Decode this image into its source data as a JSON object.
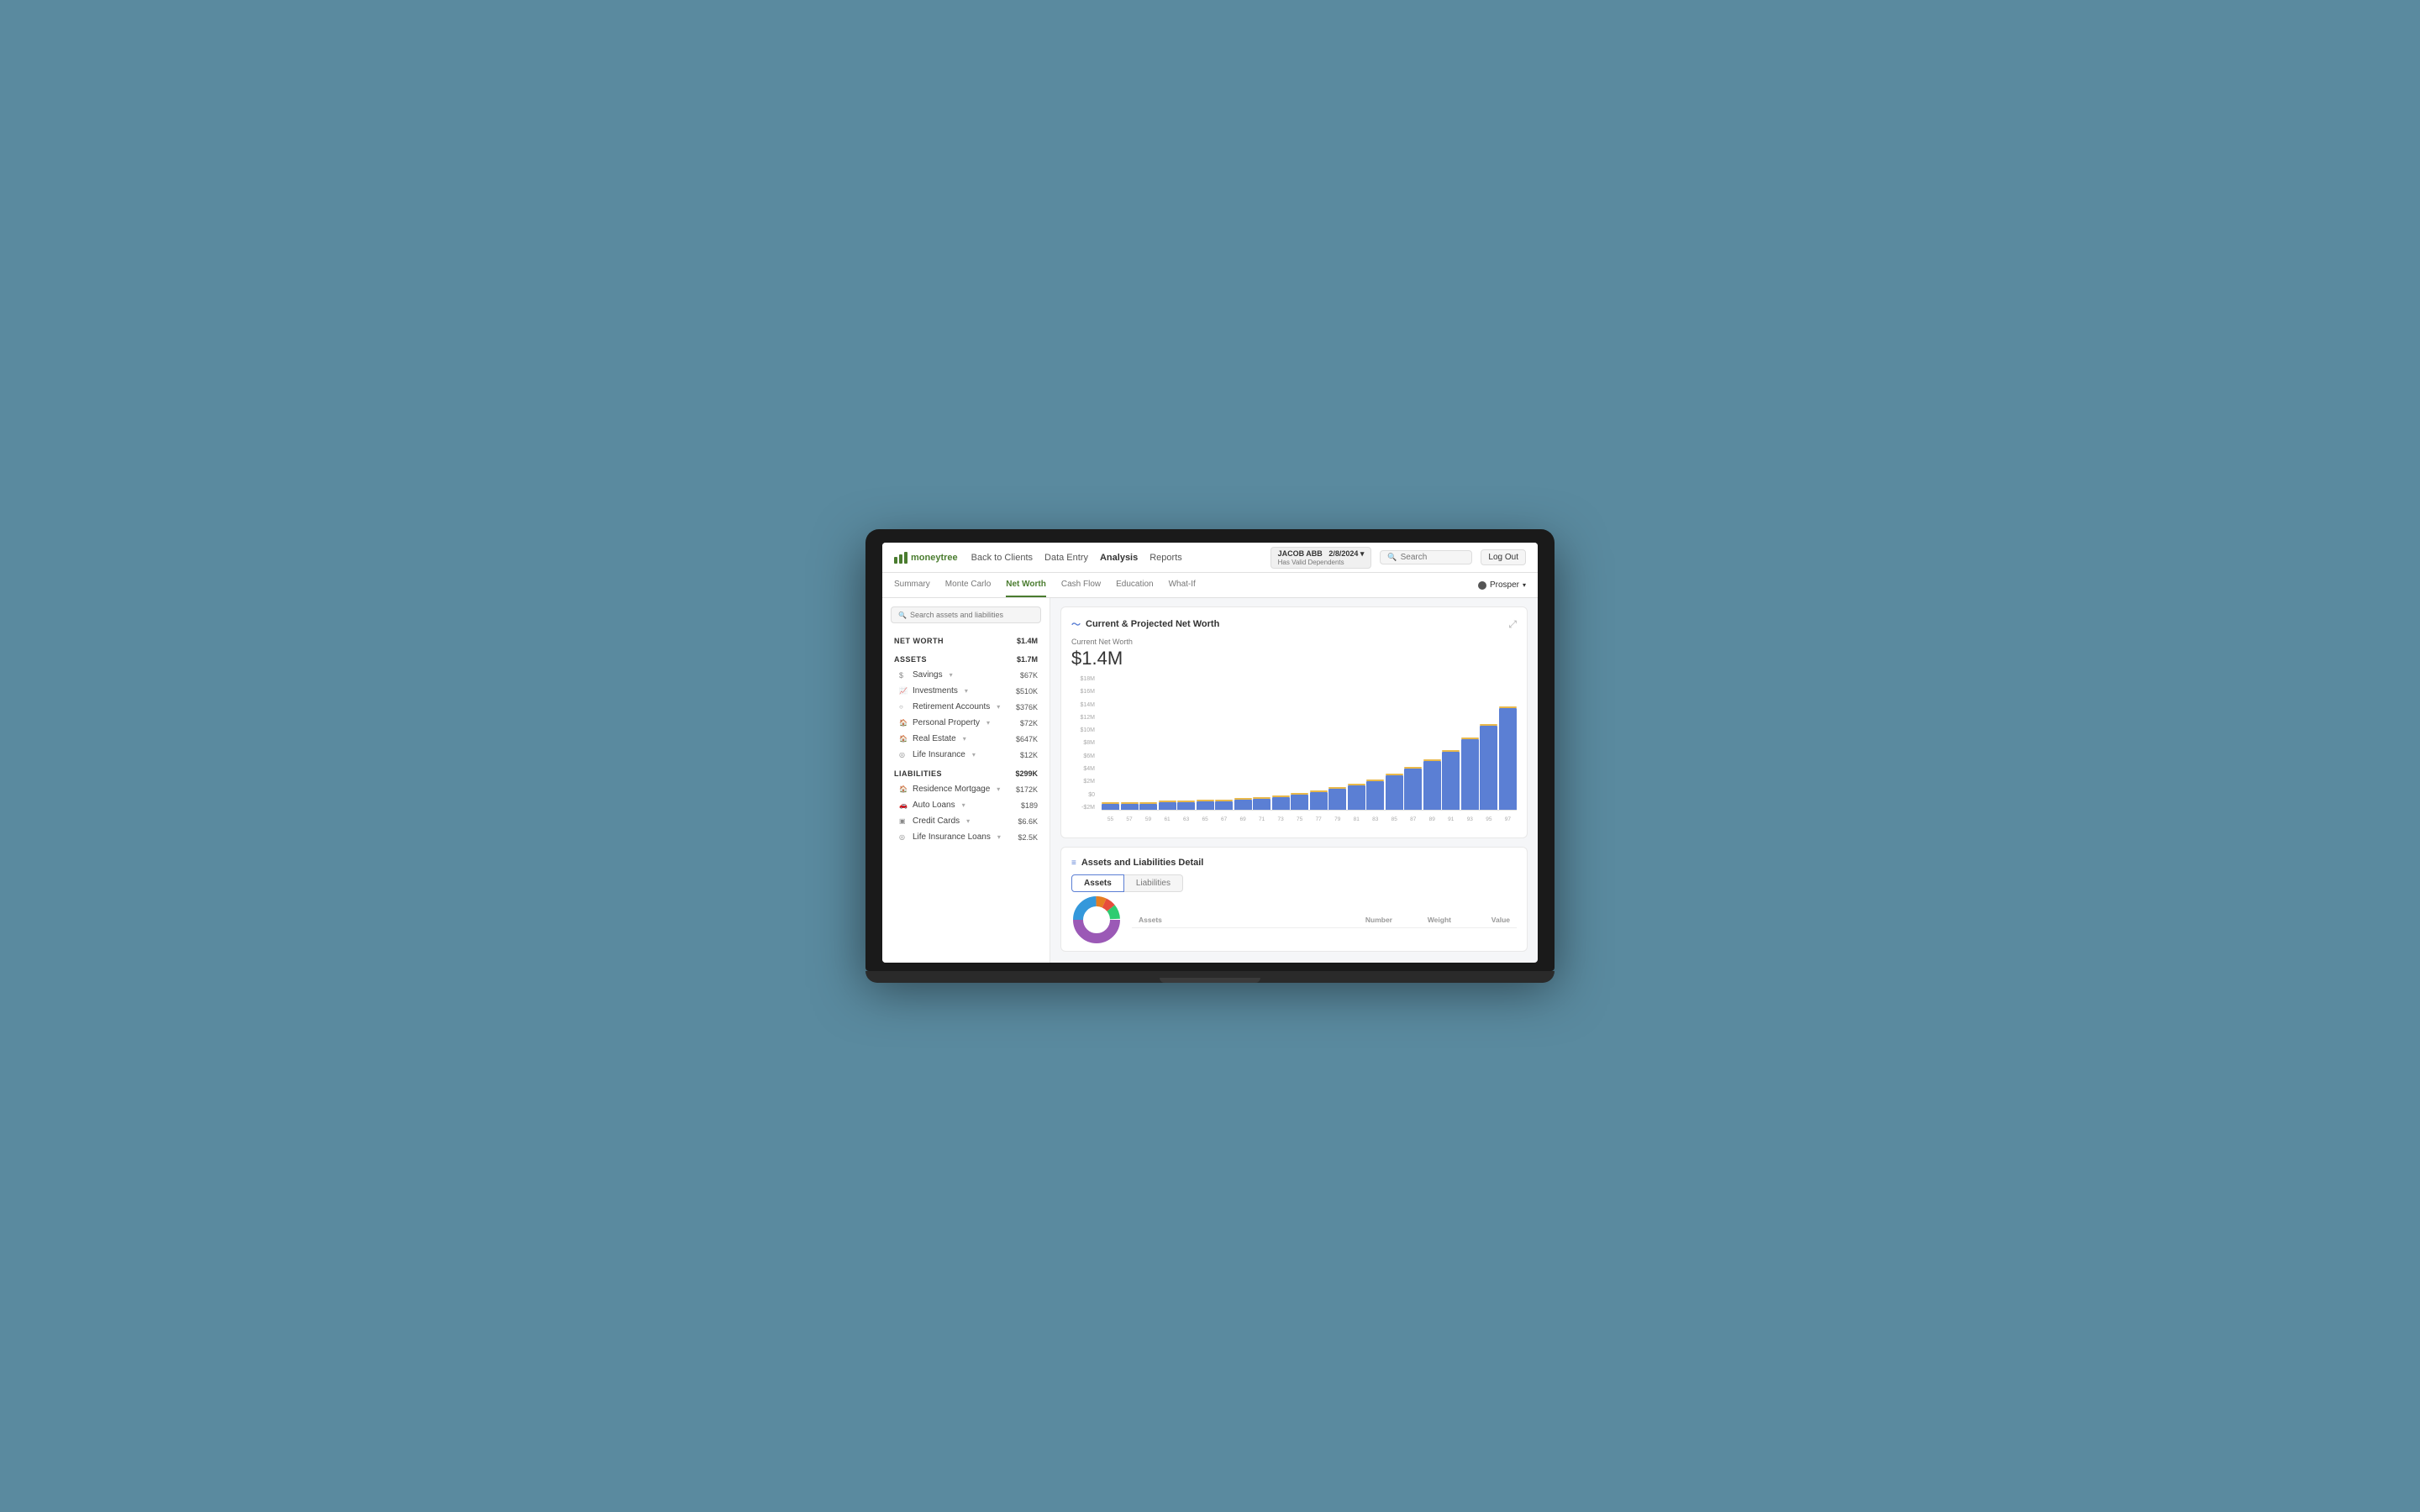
{
  "app": {
    "logo_text": "moneytree",
    "nav_links": [
      {
        "label": "Back to Clients",
        "active": false
      },
      {
        "label": "Data Entry",
        "active": false
      },
      {
        "label": "Analysis",
        "active": true
      },
      {
        "label": "Reports",
        "active": false
      }
    ],
    "client": {
      "name": "JACOB ABB",
      "date": "2/8/2024",
      "sub": "Has Valid Dependents"
    },
    "search_placeholder": "Search",
    "logout_label": "Log Out"
  },
  "sub_nav": {
    "tabs": [
      {
        "label": "Summary",
        "active": false
      },
      {
        "label": "Monte Carlo",
        "active": false
      },
      {
        "label": "Net Worth",
        "active": true
      },
      {
        "label": "Cash Flow",
        "active": false
      },
      {
        "label": "Education",
        "active": false
      },
      {
        "label": "What-If",
        "active": false
      }
    ],
    "prosper_label": "Prosper"
  },
  "sidebar": {
    "search_placeholder": "Search assets and liabilities",
    "net_worth": {
      "label": "NET WORTH",
      "value": "$1.4M"
    },
    "assets": {
      "label": "ASSETS",
      "value": "$1.7M",
      "items": [
        {
          "icon": "$",
          "label": "Savings",
          "value": "$67K"
        },
        {
          "icon": "~",
          "label": "Investments",
          "value": "$510K"
        },
        {
          "icon": "○",
          "label": "Retirement Accounts",
          "value": "$376K"
        },
        {
          "icon": "⌂",
          "label": "Personal Property",
          "value": "$72K"
        },
        {
          "icon": "⌂",
          "label": "Real Estate",
          "value": "$647K"
        },
        {
          "icon": "◎",
          "label": "Life Insurance",
          "value": "$12K"
        }
      ]
    },
    "liabilities": {
      "label": "LIABILITIES",
      "value": "$299K",
      "items": [
        {
          "icon": "⌂",
          "label": "Residence Mortgage",
          "value": "$172K"
        },
        {
          "icon": "⌂",
          "label": "Auto Loans",
          "value": "$189"
        },
        {
          "icon": "▣",
          "label": "Credit Cards",
          "value": "$6.6K"
        },
        {
          "icon": "◎",
          "label": "Life Insurance Loans",
          "value": "$2.5K"
        }
      ]
    }
  },
  "chart": {
    "title": "Current & Projected Net Worth",
    "current_net_worth_label": "Current Net Worth",
    "current_net_worth_value": "$1.4M",
    "y_labels": [
      "$18M",
      "$16M",
      "$14M",
      "$12M",
      "$10M",
      "$8M",
      "$6M",
      "$4M",
      "$2M",
      "$0",
      "-$2M"
    ],
    "x_labels": [
      "55",
      "57",
      "59",
      "61",
      "63",
      "65",
      "67",
      "69",
      "71",
      "73",
      "75",
      "77",
      "79",
      "81",
      "83",
      "85",
      "87",
      "89",
      "91",
      "93",
      "95",
      "97"
    ],
    "bar_heights_pct": [
      5,
      5,
      5,
      6,
      6,
      7,
      7,
      8,
      9,
      10,
      12,
      14,
      16,
      19,
      22,
      26,
      31,
      37,
      44,
      53,
      63,
      76
    ],
    "zero_pct": 9
  },
  "assets_detail": {
    "title": "Assets and Liabilities Detail",
    "tabs": [
      {
        "label": "Assets",
        "active": true
      },
      {
        "label": "Liabilities",
        "active": false
      }
    ],
    "table_headers": [
      "Assets",
      "Number",
      "Weight",
      "Value"
    ]
  }
}
